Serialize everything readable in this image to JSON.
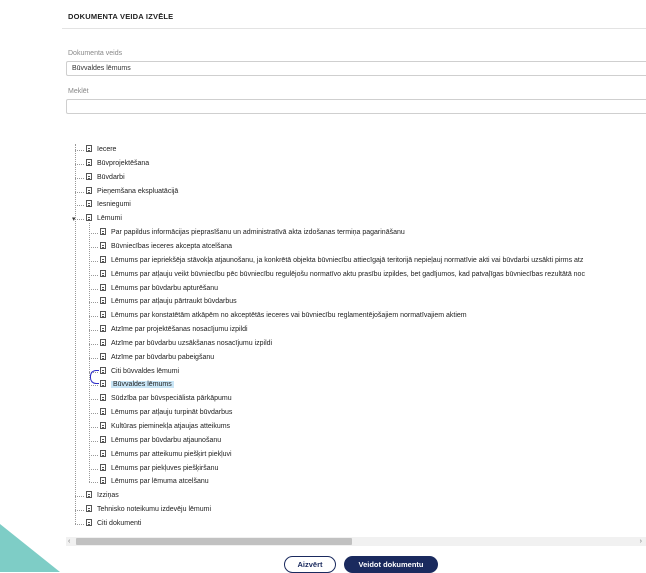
{
  "dialog": {
    "title": "DOKUMENTA VEIDA IZVĒLE",
    "doc_type_label": "Dokumenta veids",
    "doc_type_value": "Būvvaldes lēmums",
    "search_label": "Meklēt",
    "search_value": ""
  },
  "tree": {
    "top_items": [
      "Iecere",
      "Būvprojektēšana",
      "Būvdarbi",
      "Pieņemšana ekspluatācijā",
      "Iesniegumi"
    ],
    "expanded": "Lēmumi",
    "children": [
      "Par papildus informācijas pieprasīšanu un administratīvā akta izdošanas termiņa pagarināšanu",
      "Būvniecības ieceres akcepta atcelšana",
      "Lēmums par iepriekšēja stāvokļa atjaunošanu, ja konkrētā objekta būvniecību attiecīgajā teritorijā nepieļauj normatīvie akti vai būvdarbi uzsākti pirms atz",
      "Lēmums par atļauju veikt būvniecību pēc būvniecību regulējošu normatīvo aktu prasību izpildes, bet gadījumos, kad patvaļīgas būvniecības rezultātā noc",
      "Lēmums par būvdarbu apturēšanu",
      "Lēmums par atļauju pārtraukt būvdarbus",
      "Lēmums par konstatētām atkāpēm no akceptētās ieceres vai būvniecību reglamentējošajiem normatīvajiem aktiem",
      "Atzīme par projektēšanas nosacījumu izpildi",
      "Atzīme par būvdarbu uzsākšanas nosacījumu izpildi",
      "Atzīme par būvdarbu pabeigšanu",
      "Citi būvvaldes lēmumi",
      "Būvvaldes lēmums",
      "Sūdzība par būvspeciālista pārkāpumu",
      "Lēmums par atļauju turpināt būvdarbus",
      "Kultūras pieminekļa atjaujas atteikums",
      "Lēmums par būvdarbu atjaunošanu",
      "Lēmums par atteikumu piešķirt piekļuvi",
      "Lēmums par piekļuves piešķiršanu",
      "Lēmums par lēmuma atcelšanu"
    ],
    "selected": "Būvvaldes lēmums",
    "bottom_items": [
      "Izziņas",
      "Tehnisko noteikumu izdevēju lēmumi",
      "Citi dokumenti"
    ]
  },
  "buttons": {
    "close": "Aizvērt",
    "create": "Veidot dokumentu"
  },
  "colors": {
    "primary": "#1a2a5e",
    "selected_bg": "#c9e6f7",
    "corner": "#7ecdc6"
  }
}
